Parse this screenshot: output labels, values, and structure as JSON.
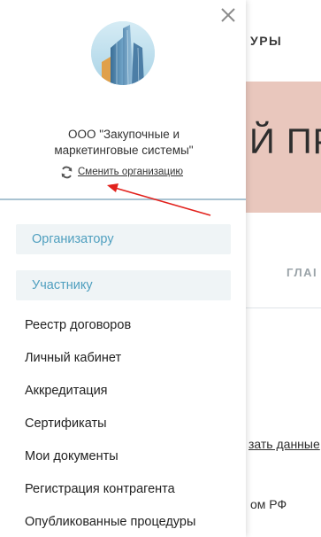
{
  "background": {
    "header_fragment": "УРЫ",
    "banner_fragment": "Й ПР",
    "tab_fragment": "ГЛАІ",
    "link_fragment": "зать данные",
    "text_fragment": "ом РФ"
  },
  "drawer": {
    "organization_name": "ООО \"Закупочные и маркетинговые системы\"",
    "change_org_label": "Сменить организацию",
    "roles": {
      "organizer": "Организатору",
      "participant": "Участнику"
    },
    "menu_items": [
      "Реестр договоров",
      "Личный кабинет",
      "Аккредитация",
      "Сертификаты",
      "Мои документы",
      "Регистрация контрагента",
      "Опубликованные процедуры"
    ],
    "icons": {
      "close": "close-icon",
      "logo": "company-logo",
      "refresh": "refresh-icon"
    }
  },
  "colors": {
    "role_text": "#4f9fbf",
    "role_bg": "#eff4f6",
    "header_border": "#a9c3d2",
    "annotation_arrow": "#e2211c"
  }
}
